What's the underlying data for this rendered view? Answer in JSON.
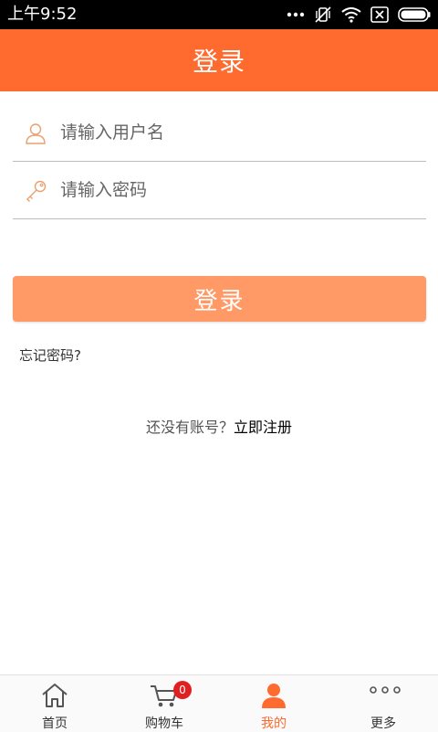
{
  "status_bar": {
    "time": "上午9:52"
  },
  "header": {
    "title": "登录"
  },
  "form": {
    "username_placeholder": "请输入用户名",
    "username_value": "",
    "password_placeholder": "请输入密码",
    "password_value": "",
    "login_button_label": "登录",
    "forgot_password_label": "忘记密码?"
  },
  "register": {
    "prompt": "还没有账号？",
    "link_label": "立即注册"
  },
  "bottom_nav": {
    "items": [
      {
        "label": "首页",
        "icon": "home-icon"
      },
      {
        "label": "购物车",
        "icon": "cart-icon",
        "badge": "0"
      },
      {
        "label": "我的",
        "icon": "user-icon",
        "active": true
      },
      {
        "label": "更多",
        "icon": "more-icon"
      }
    ]
  },
  "colors": {
    "accent": "#ff6a2f",
    "button": "#ff9966",
    "badge": "#e02020"
  }
}
